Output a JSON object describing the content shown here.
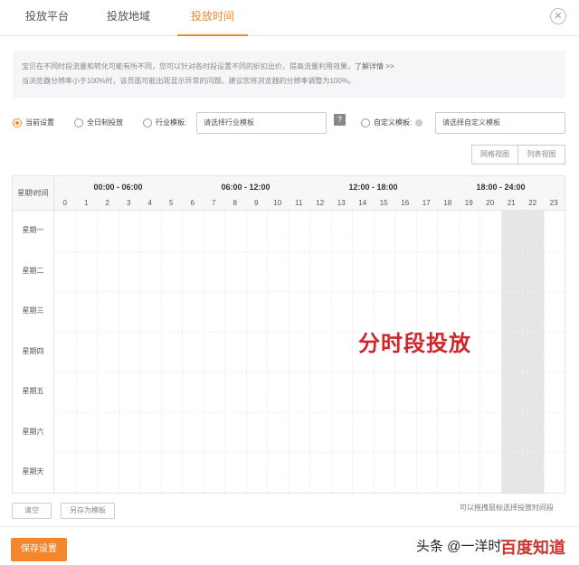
{
  "tabs": [
    {
      "label": "投放平台",
      "active": false
    },
    {
      "label": "投放地域",
      "active": false
    },
    {
      "label": "投放时间",
      "active": true
    }
  ],
  "notice": {
    "line1": "宝贝在不同时段流量和转化可能有所不同，您可以针对各时段设置不同的折扣出价，提高流量利用效果，",
    "line1_link": "了解详情 >>",
    "line2": "当浏览器分辨率小于100%时，该页面可能出现显示异常的问题。建议您将浏览器的分辨率调整为100%。"
  },
  "options": {
    "current_setting": "当前设置",
    "all_day": "全日制投放",
    "industry_template": "行业模板:",
    "industry_placeholder": "请选择行业模板",
    "custom_template": "自定义模板:",
    "custom_placeholder": "请选择自定义模板",
    "help_glyph": "?",
    "selected": "current_setting"
  },
  "view_buttons": {
    "grid_view": "网格视图",
    "list_view": "列表视图"
  },
  "grid": {
    "corner_label": "星期\\时间",
    "time_ranges": [
      "00:00 - 06:00",
      "06:00 - 12:00",
      "12:00 - 18:00",
      "18:00 - 24:00"
    ],
    "hours": [
      "0",
      "1",
      "2",
      "3",
      "4",
      "5",
      "6",
      "7",
      "8",
      "9",
      "10",
      "11",
      "12",
      "13",
      "14",
      "15",
      "16",
      "17",
      "18",
      "19",
      "20",
      "21",
      "22",
      "23"
    ],
    "days": [
      "星期一",
      "星期二",
      "星期三",
      "星期四",
      "星期五",
      "星期六",
      "星期天"
    ],
    "highlighted_hours": [
      21,
      22
    ],
    "overlay_text": "分时段投放"
  },
  "bottom": {
    "clear_label": "清空",
    "save_template_label": "另存为模板",
    "hint": "可以拖拽鼠标选择投放时间段",
    "save_label": "保存设置",
    "watermark": "头条 @一洋时",
    "brand": "百度知道"
  },
  "colors": {
    "accent": "#f4862b",
    "overlay_red": "#d0262b",
    "selection_gray": "#e6e6e6"
  }
}
